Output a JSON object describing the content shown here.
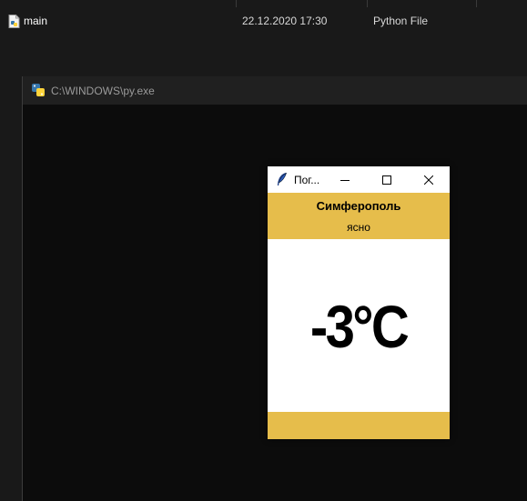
{
  "explorer": {
    "file": {
      "name": "main",
      "date": "22.12.2020 17:30",
      "type": "Python File",
      "icon": "python-file-icon"
    }
  },
  "console": {
    "title": "C:\\WINDOWS\\py.exe",
    "icon": "python-launcher-icon"
  },
  "app": {
    "title": "Пог...",
    "icon": "tk-feather-icon",
    "city": "Симферополь",
    "description": "ясно",
    "temperature": "-3°C",
    "accent_color": "#e6bd4b",
    "controls": [
      "minimize-icon",
      "maximize-icon",
      "close-icon"
    ]
  }
}
